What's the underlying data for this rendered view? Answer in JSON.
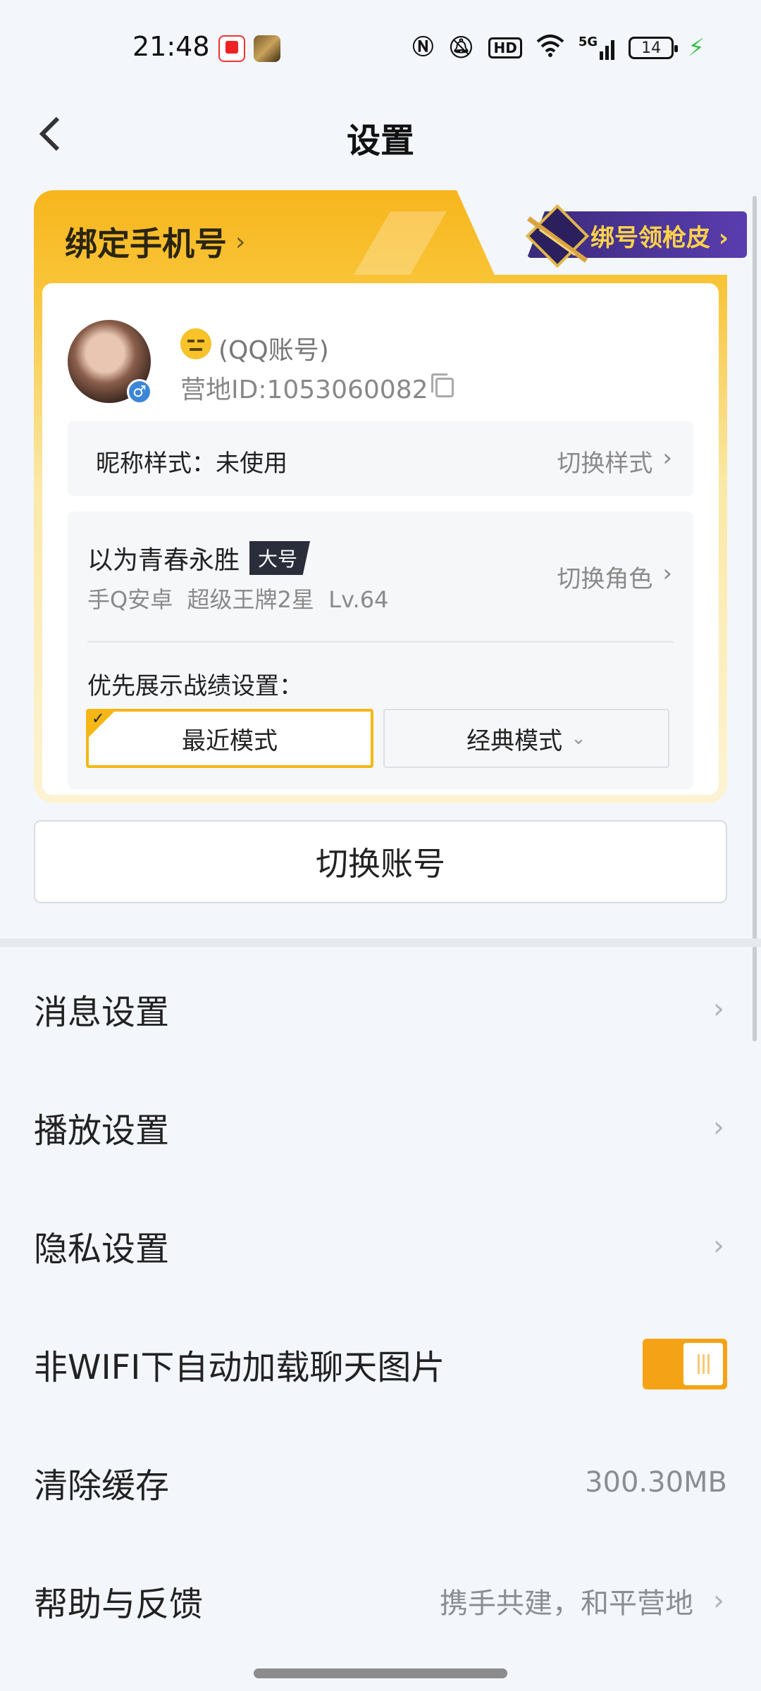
{
  "status_bar": {
    "time": "21:48",
    "network": "5G",
    "battery": "14",
    "icons": [
      "nfc-icon",
      "mute-icon",
      "hd-icon",
      "wifi-icon",
      "signal-icon",
      "battery-icon",
      "charging-icon"
    ]
  },
  "header": {
    "title": "设置"
  },
  "account_card": {
    "bind_phone": "绑定手机号",
    "promo": "绑号领枪皮",
    "account_name": "(QQ账号)",
    "camp_id": "营地ID:1053060082",
    "nickname_style_label": "昵称样式：未使用",
    "nickname_style_action": "切换样式",
    "role_name": "以为青春永胜",
    "role_tag": "大号",
    "role_sub": "手Q安卓  超级王牌2星  Lv.64",
    "switch_role": "切换角色",
    "pref_label": "优先展示战绩设置：",
    "mode_recent": "最近模式",
    "mode_classic": "经典模式"
  },
  "switch_account": "切换账号",
  "settings": {
    "message": "消息设置",
    "playback": "播放设置",
    "privacy": "隐私设置",
    "auto_load": "非WIFI下自动加载聊天图片",
    "auto_load_on": true,
    "clear_cache": "清除缓存",
    "cache_size": "300.30MB",
    "help": "帮助与反馈",
    "help_value": "携手共建，和平营地"
  },
  "colors": {
    "accent": "#f5b716",
    "toggle_on": "#f5a316",
    "promo_bg": "#4a33a0",
    "promo_text": "#ffd448"
  }
}
